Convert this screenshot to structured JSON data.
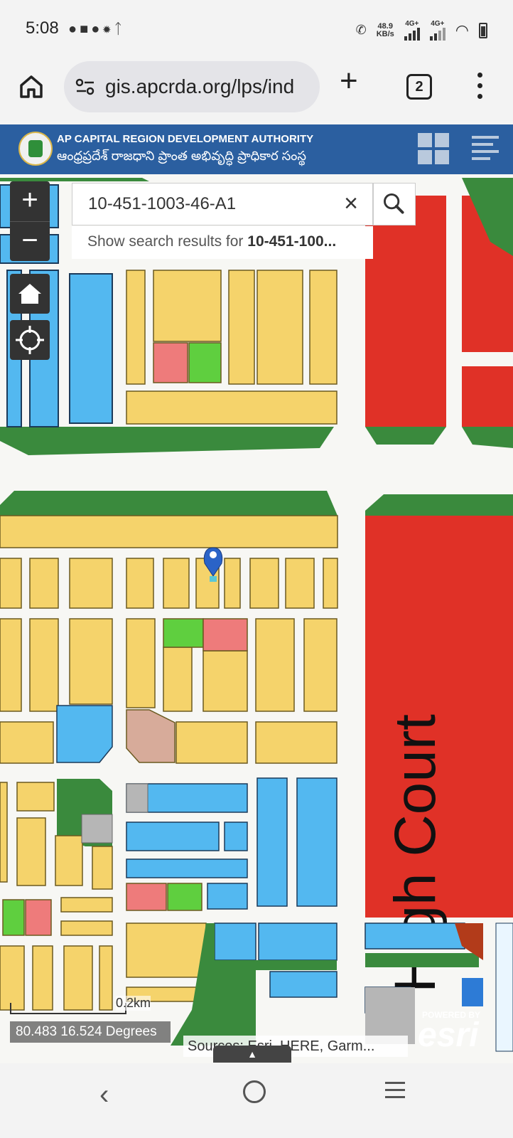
{
  "status": {
    "time": "5:08",
    "net_speed_value": "48.9",
    "net_speed_unit": "KB/s",
    "sim1": "4G+",
    "sim2": "4G+"
  },
  "browser": {
    "url": "gis.apcrda.org/lps/ind",
    "tab_count": "2"
  },
  "app": {
    "title": "AP CAPITAL REGION DEVELOPMENT AUTHORITY",
    "subtitle": "ఆంధ్రప్రదేశ్ రాజధాని ప్రాంత అభివృద్ధి ప్రాధికార సంస్థ"
  },
  "search": {
    "value": "10-451-1003-46-A1",
    "suggestion_prefix": "Show search results for ",
    "suggestion_term": "10-451-100..."
  },
  "map": {
    "zoom_in": "+",
    "zoom_out": "−",
    "feature_label": "High Court",
    "scale_label": "0.2km",
    "coordinates": "80.483 16.524 Degrees",
    "attribution": "Sources: Esri, HERE, Garm...",
    "esri_powered": "POWERED BY",
    "esri_name": "esri",
    "colors": {
      "residential": "#f5d36b",
      "commercial": "#e03127",
      "institutional": "#53b8f0",
      "green": "#3a8a3d",
      "park": "#5fcf3f",
      "pink": "#ee7b7b",
      "grey": "#b6b6b6",
      "brown": "#d7ab9a"
    }
  }
}
